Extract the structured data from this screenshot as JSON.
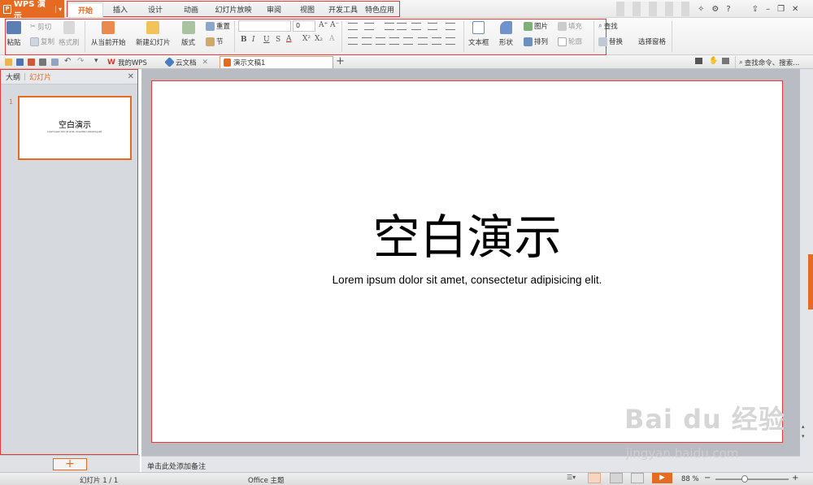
{
  "app": {
    "name": "WPS 演示",
    "menu_dropdown": "▾"
  },
  "menu_tabs": [
    {
      "label": "开始",
      "active": true
    },
    {
      "label": "插入"
    },
    {
      "label": "设计"
    },
    {
      "label": "动画"
    },
    {
      "label": "幻灯片放映"
    },
    {
      "label": "审阅"
    },
    {
      "label": "视图"
    },
    {
      "label": "开发工具"
    },
    {
      "label": "特色应用"
    }
  ],
  "window_controls": {
    "help": "?",
    "minimize": "–",
    "restore": "❐",
    "close": "✕"
  },
  "ribbon": {
    "paste": "粘贴",
    "cut": "剪切",
    "copy": "复制",
    "format_painter": "格式刷",
    "from_current": "从当前开始",
    "new_slide": "新建幻灯片",
    "layout": "版式",
    "reset": "重置",
    "section": "节",
    "font_size": "0",
    "text_box": "文本框",
    "shape": "形状",
    "picture": "图片",
    "fill": "填充",
    "arrange": "排列",
    "outline": "轮廓",
    "find": "查找",
    "replace": "替换",
    "select_pane": "选择窗格"
  },
  "doc_tabs": [
    {
      "label": "我的WPS"
    },
    {
      "label": "云文档"
    },
    {
      "label": "演示文稿1",
      "active": true
    }
  ],
  "search_command": "查找命令、搜索...",
  "left_pane": {
    "tab_outline": "大纲",
    "tab_slides": "幻灯片",
    "add": "+"
  },
  "thumbnail": {
    "number": "1",
    "title": "空白演示",
    "subtitle": "Lorem ipsum dolor sit amet, consectetur adipisicing elit."
  },
  "slide": {
    "title": "空白演示",
    "subtitle": "Lorem ipsum dolor sit amet, consectetur adipisicing elit."
  },
  "notes_placeholder": "单击此处添加备注",
  "status": {
    "slide_info": "幻灯片 1 / 1",
    "theme": "Office 主题",
    "zoom": "88 %",
    "zoom_level": 0.4
  },
  "watermark": {
    "logo": "Bai du 经验",
    "url": "jingyan.baidu.com"
  },
  "colors": {
    "accent": "#e56b22",
    "highlight_frame": "#e23b3b"
  }
}
